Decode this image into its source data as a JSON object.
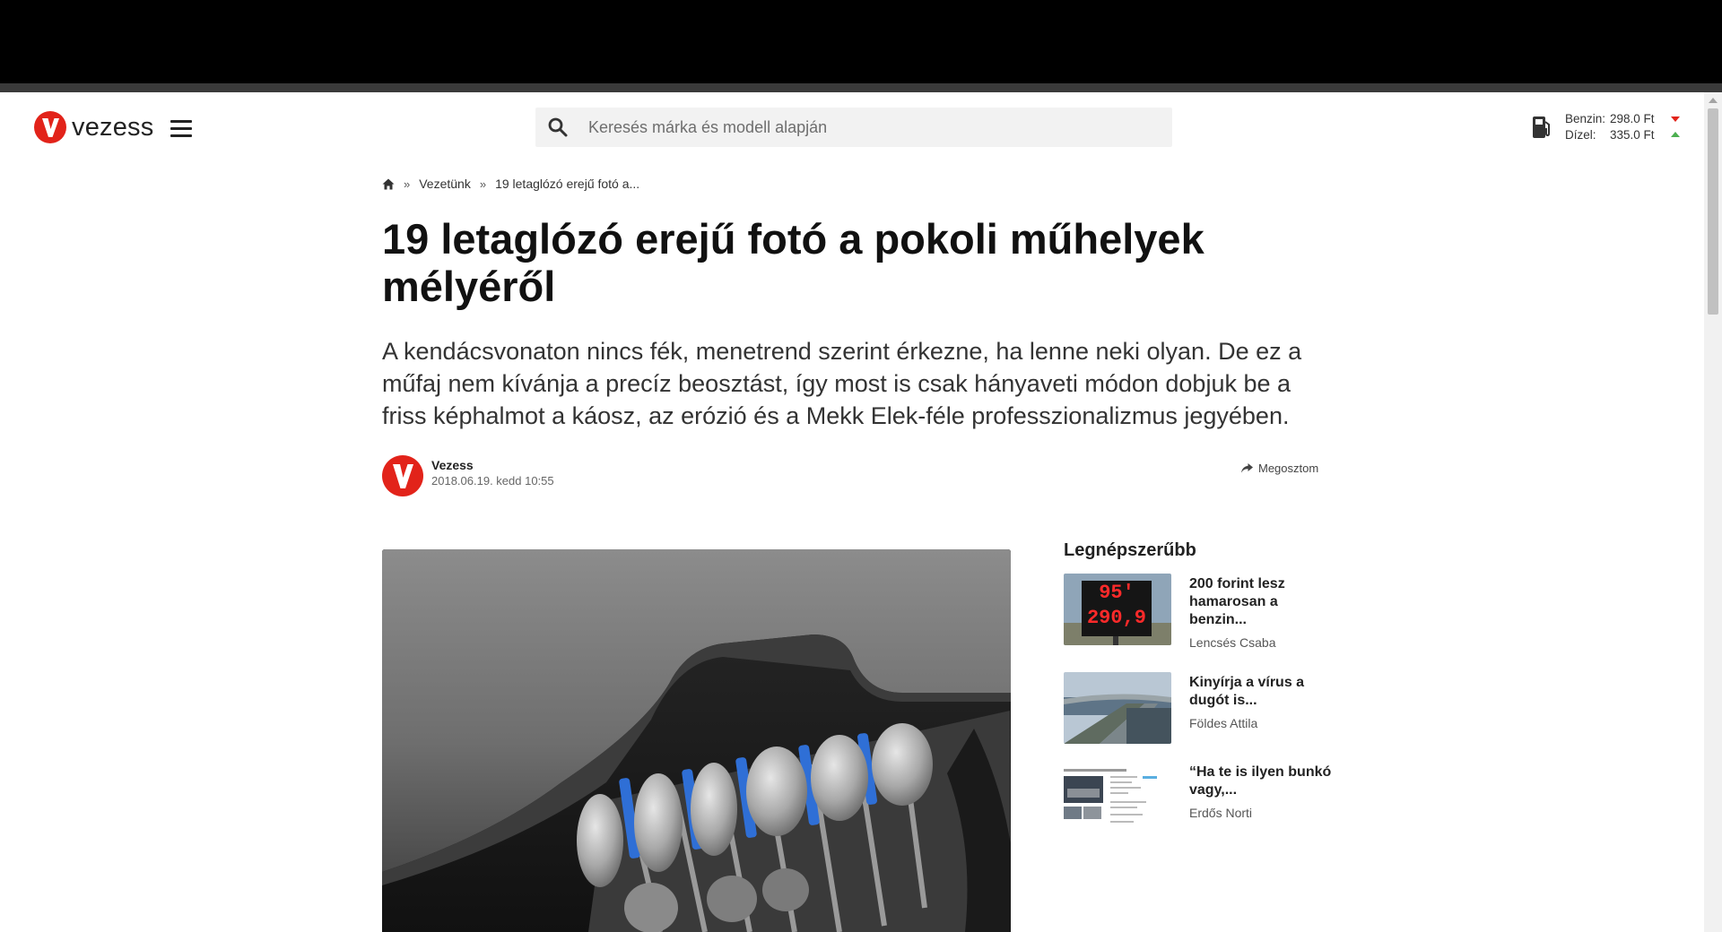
{
  "header": {
    "brand_name": "vezess",
    "search_placeholder": "Keresés márka és modell alapján",
    "fuel": [
      {
        "label": "Benzin:",
        "price": "298.0 Ft",
        "trend": "down"
      },
      {
        "label": "Dízel:",
        "price": "335.0 Ft",
        "trend": "up"
      }
    ]
  },
  "breadcrumb": {
    "items": [
      "Vezetünk",
      "19 letaglózó erejű fotó a..."
    ],
    "separator": "»"
  },
  "article": {
    "title": "19 letaglózó erejű fotó a pokoli műhelyek mélyéről",
    "lead": "A kendácsvonaton nincs fék, menetrend szerint érkezne, ha lenne neki olyan. De ez a műfaj nem kívánja a precíz beosztást, így most is csak hányaveti módon dobjuk be a friss képhalmot a káosz, az erózió és a Mekk Elek-féle professzionalizmus jegyében.",
    "author": "Vezess",
    "date": "2018.06.19. kedd 10:55",
    "share_label": "Megosztom"
  },
  "sidebar": {
    "popular_title": "Legnépszerűbb",
    "items": [
      {
        "headline": "200 forint lesz hamarosan a benzin...",
        "author": "Lencsés Csaba",
        "thumb_text_1": "95'",
        "thumb_text_2": "290,9"
      },
      {
        "headline": "Kinyírja a vírus a dugót is...",
        "author": "Földes Attila"
      },
      {
        "headline": "“Ha te is ilyen bunkó vagy,...",
        "author": "Erdős Norti"
      }
    ]
  },
  "colors": {
    "brand_red": "#e2231a",
    "price_down": "#e2231a",
    "price_up": "#4caf50"
  }
}
